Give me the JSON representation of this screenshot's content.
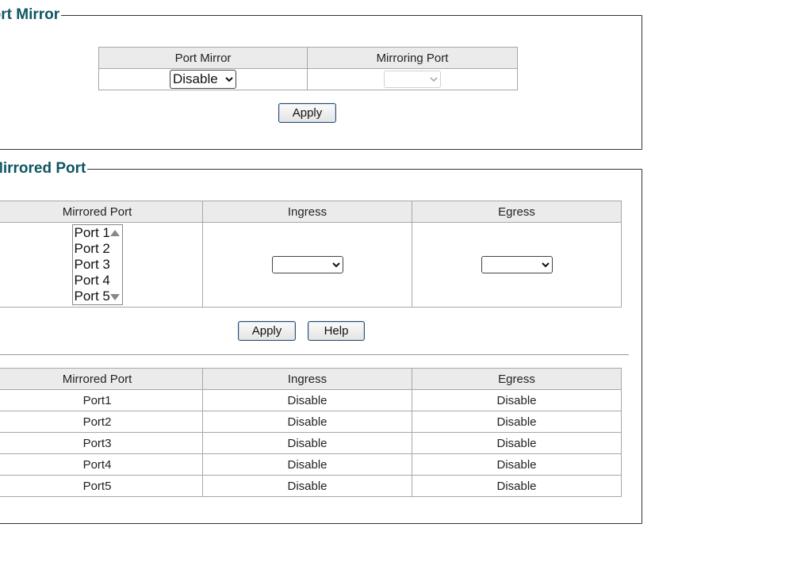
{
  "port_mirror_section": {
    "title": "Port Mirror",
    "headers": [
      "Port Mirror",
      "Mirroring Port"
    ],
    "port_mirror_value": "Disable",
    "mirroring_port_value": "",
    "apply_label": "Apply"
  },
  "mirrored_port_section": {
    "title": "Mirrored Port",
    "headers": [
      "Mirrored Port",
      "Ingress",
      "Egress"
    ],
    "port_options": [
      "Port 1",
      "Port 2",
      "Port 3",
      "Port 4",
      "Port 5"
    ],
    "ingress_value": "",
    "egress_value": "",
    "apply_label": "Apply",
    "help_label": "Help"
  },
  "status_table": {
    "headers": [
      "Mirrored Port",
      "Ingress",
      "Egress"
    ],
    "rows": [
      {
        "port": "Port1",
        "ingress": "Disable",
        "egress": "Disable"
      },
      {
        "port": "Port2",
        "ingress": "Disable",
        "egress": "Disable"
      },
      {
        "port": "Port3",
        "ingress": "Disable",
        "egress": "Disable"
      },
      {
        "port": "Port4",
        "ingress": "Disable",
        "egress": "Disable"
      },
      {
        "port": "Port5",
        "ingress": "Disable",
        "egress": "Disable"
      }
    ]
  }
}
